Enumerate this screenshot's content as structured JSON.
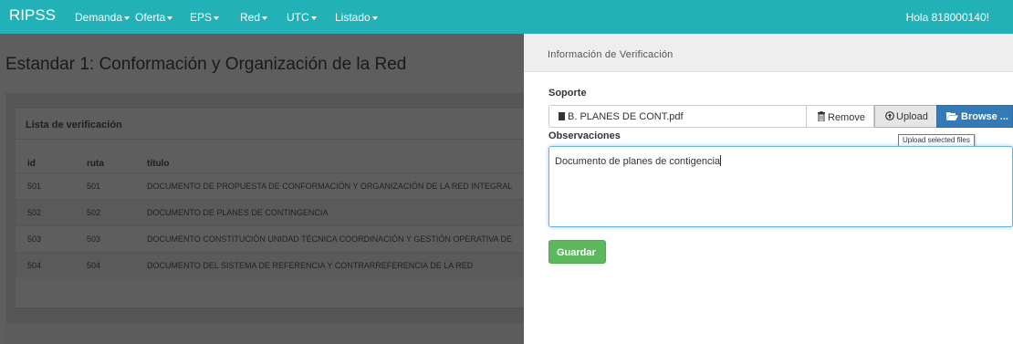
{
  "nav": {
    "brand": "RIPSS",
    "items": [
      {
        "label": "Demanda"
      },
      {
        "label": "Oferta"
      },
      {
        "label": "EPS"
      },
      {
        "label": "Red"
      },
      {
        "label": "UTC"
      },
      {
        "label": "Listado"
      }
    ],
    "greeting": "Hola 818000140!",
    "color": "#22b1b6"
  },
  "page": {
    "title": "Estandar 1: Conformación y Organización de la Red",
    "checklist": {
      "heading": "Lista de verificación",
      "columns": [
        "id",
        "ruta",
        "título"
      ],
      "rows": [
        {
          "id": "501",
          "ruta": "501",
          "titulo": "DOCUMENTO DE PROPUESTA DE CONFORMACIÓN Y ORGANIZACIÓN DE LA RED INTEGRAL"
        },
        {
          "id": "502",
          "ruta": "502",
          "titulo": "DOCUMENTO DE PLANES DE CONTINGENCIA"
        },
        {
          "id": "503",
          "ruta": "503",
          "titulo": "DOCUMENTO CONSTITUCIÓN UNIDAD TÉCNICA COORDINACIÓN Y GESTIÓN OPERATIVA DE"
        },
        {
          "id": "504",
          "ruta": "504",
          "titulo": "DOCUMENTO DEL SISTEMA DE REFERENCIA Y CONTRARREFERENCIA DE LA RED"
        }
      ]
    }
  },
  "panel": {
    "title": "Información de Verificación",
    "soporte_label": "Soporte",
    "file_name": "B. PLANES DE CONT.pdf",
    "remove_label": "Remove",
    "upload_label": "Upload",
    "browse_label": "Browse ...",
    "tooltip": "Upload selected files",
    "observaciones_label": "Observaciones",
    "observaciones_value": "Documento de planes de contigencia",
    "save_label": "Guardar"
  },
  "colors": {
    "primary": "#337ab7",
    "success": "#5cb85c"
  },
  "icons": [
    "file-icon",
    "trash-icon",
    "upload-icon",
    "folder-open-icon",
    "caret-down-icon"
  ]
}
